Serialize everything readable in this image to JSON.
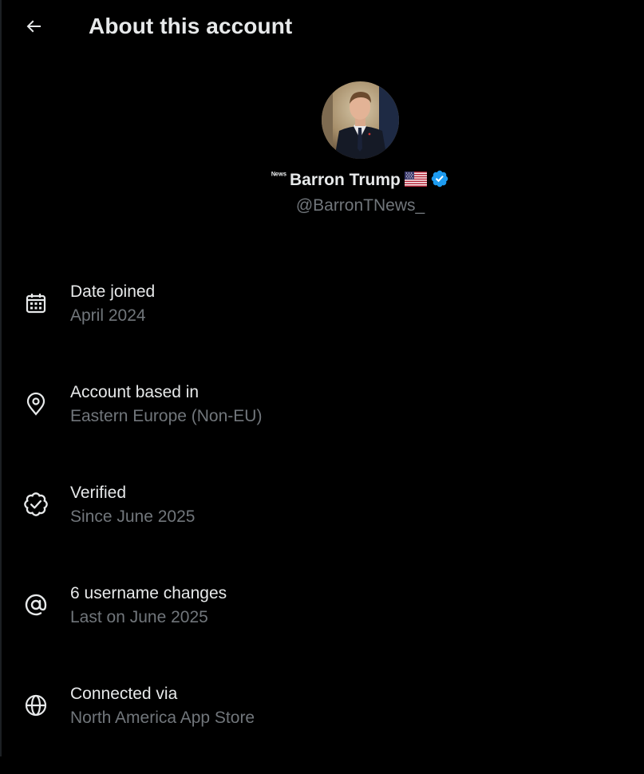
{
  "header": {
    "title": "About this account",
    "back_icon": "arrow-left-icon"
  },
  "profile": {
    "news_tag": "ᴺᵉʷˢ",
    "display_name": "Barron Trump",
    "flag_icon": "us-flag-icon",
    "verified_icon": "verified-badge-icon",
    "handle": "@BarronTNews_",
    "verified_color": "#1d9bf0"
  },
  "info": [
    {
      "icon": "calendar-icon",
      "title": "Date joined",
      "value": "April 2024"
    },
    {
      "icon": "location-pin-icon",
      "title": "Account based in",
      "value": "Eastern Europe (Non-EU)"
    },
    {
      "icon": "verified-check-icon",
      "title": "Verified",
      "value": "Since June 2025"
    },
    {
      "icon": "at-sign-icon",
      "title": "6 username changes",
      "value": "Last on June 2025"
    },
    {
      "icon": "globe-icon",
      "title": "Connected via",
      "value": "North America App Store"
    }
  ],
  "colors": {
    "background": "#000000",
    "primary_text": "#e7e9ea",
    "secondary_text": "#71767b"
  }
}
